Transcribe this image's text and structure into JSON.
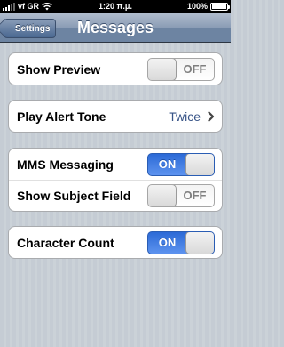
{
  "status_bar": {
    "carrier": "vf GR",
    "time": "1:20 π.μ.",
    "battery_percent": "100%",
    "battery_level": 1.0
  },
  "nav": {
    "back_label": "Settings",
    "title": "Messages"
  },
  "settings": {
    "show_preview": {
      "label": "Show Preview",
      "state": "OFF"
    },
    "play_alert_tone": {
      "label": "Play Alert Tone",
      "value": "Twice"
    },
    "mms_messaging": {
      "label": "MMS Messaging",
      "state": "ON"
    },
    "show_subject_field": {
      "label": "Show Subject Field",
      "state": "OFF"
    },
    "character_count": {
      "label": "Character Count",
      "state": "ON"
    }
  },
  "colors": {
    "switch_on": "#2c6ad6",
    "value_text": "#385487",
    "nav_bar": "#6d84a2"
  }
}
